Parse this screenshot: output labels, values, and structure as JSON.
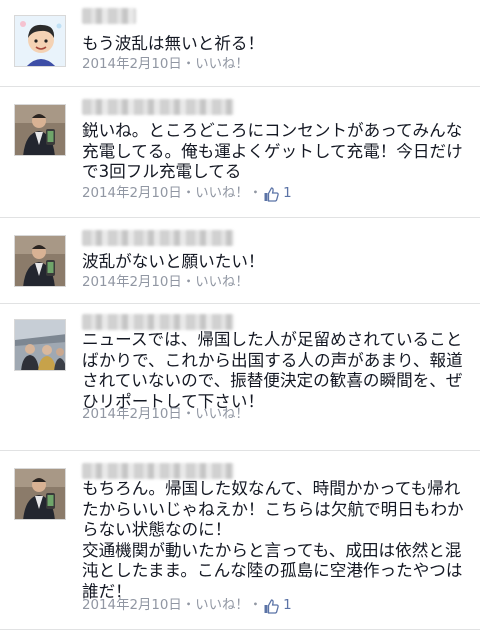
{
  "comments": [
    {
      "text": "もう波乱は無いと祈る！",
      "date": "2014年2月10日",
      "sep": "・",
      "like_label": "いいね！",
      "like_count": null,
      "avatar": "cartoon-avatar"
    },
    {
      "text": "鋭いね。ところどころにコンセントがあってみんな充電してる。俺も運よくゲットして充電！今日だけで3回フル充電してる",
      "date": "2014年2月10日",
      "sep": "・",
      "like_label": "いいね！",
      "sep2": "・",
      "like_count": "1",
      "avatar": "selfie-avatar"
    },
    {
      "text": "波乱がないと願いたい！",
      "date": "2014年2月10日",
      "sep": "・",
      "like_label": "いいね！",
      "like_count": null,
      "avatar": "selfie-avatar"
    },
    {
      "text": "ニュースでは、帰国した人が足留めされていることばかりで、これから出国する人の声があまり、報道されていないので、振替便決定の歓喜の瞬間を、ぜひリポートして下さい！",
      "date": "2014年2月10日",
      "sep": "・",
      "like_label": "いいね！",
      "like_count": null,
      "avatar": "group-photo-avatar"
    },
    {
      "text": "もちろん。帰国した奴なんて、時間かかっても帰れたからいいじゃねえか！こちらは欠航で明日もわからない状態なのに！\n交通機関が動いたからと言っても、成田は依然と混沌としたまま。こんな陸の孤島に空港作ったやつは誰だ！",
      "date": "2014年2月10日",
      "sep": "・",
      "like_label": "いいね！",
      "sep2": "・",
      "like_count": "1",
      "avatar": "selfie-avatar"
    }
  ],
  "colors": {
    "meta": "#9197a3",
    "link": "#5b73a6",
    "divider": "#e1e2e3"
  }
}
